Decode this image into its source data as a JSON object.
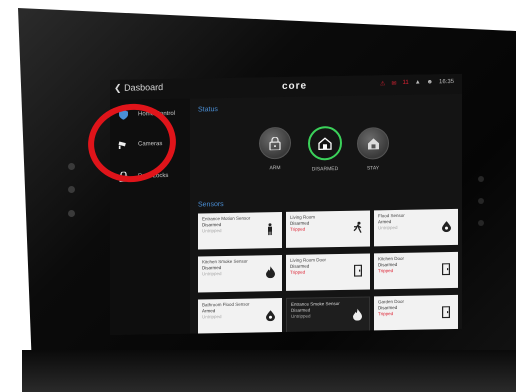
{
  "topbar": {
    "back_label": "Dasboard",
    "logo": "core",
    "status": {
      "mail_count": "11",
      "time": "16:35"
    }
  },
  "sidebar": {
    "items": [
      {
        "label": "Home Control",
        "icon": "shield-icon"
      },
      {
        "label": "Cameras",
        "icon": "camera-icon"
      },
      {
        "label": "Door Locks",
        "icon": "lock-icon"
      }
    ]
  },
  "status_section": {
    "title": "Status",
    "modes": [
      {
        "label": "ARM",
        "icon": "lock-icon",
        "active": false
      },
      {
        "label": "DISARMED",
        "icon": "home-icon",
        "active": true
      },
      {
        "label": "STAY",
        "icon": "home-lock-icon",
        "active": false
      }
    ]
  },
  "sensors_section": {
    "title": "Sensors",
    "cards": [
      {
        "name": "Entrance Motion Sensor",
        "state": "Disarmed",
        "sub": "Untripped",
        "icon": "person-icon",
        "alert": false
      },
      {
        "name": "Living Room",
        "state": "Disarmed",
        "sub": "Tripped",
        "icon": "running-person-icon",
        "alert": true
      },
      {
        "name": "Flood Sensor",
        "state": "Armed",
        "sub": "Untripped",
        "icon": "drop-icon",
        "alert": false
      },
      {
        "name": "Kitchen Smoke Sensor",
        "state": "Disarmed",
        "sub": "Untripped",
        "icon": "flame-icon",
        "alert": false
      },
      {
        "name": "Living Room Door",
        "state": "Disarmed",
        "sub": "Tripped",
        "icon": "door-icon",
        "alert": true
      },
      {
        "name": "Kitchen Door",
        "state": "Disarmed",
        "sub": "Tripped",
        "icon": "door-icon",
        "alert": true
      },
      {
        "name": "Bathroom Flood Sensor",
        "state": "Armed",
        "sub": "Untripped",
        "icon": "drop-icon",
        "alert": false
      },
      {
        "name": "Entrance Smoke Sensor",
        "state": "Disarmed",
        "sub": "Untripped",
        "icon": "flame-icon",
        "alert": false
      },
      {
        "name": "Garden Door",
        "state": "Disarmed",
        "sub": "Tripped",
        "icon": "door-icon",
        "alert": true
      }
    ]
  },
  "colors": {
    "accent": "#4a8fd6",
    "active_ring": "#3bd15a",
    "alert": "#d23333",
    "highlight": "#e0141a"
  }
}
